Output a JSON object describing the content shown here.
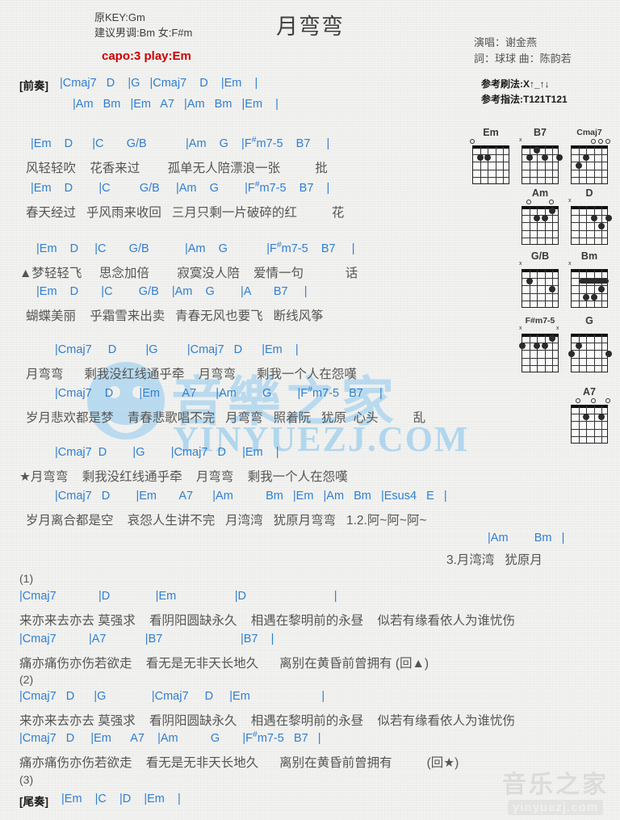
{
  "header": {
    "original_key": "原KEY:Gm",
    "suggested_key": "建议男调:Bm 女:F#m",
    "capo": "capo:3 play:Em",
    "title": "月弯弯",
    "singer": "演唱：谢金燕",
    "credits": "詞：球球  曲：陈韵若",
    "strum_pattern": "参考刷法:X↑_↑↓",
    "picking_pattern": "参考指法:T121T121",
    "capo_color": "#cc0000",
    "chord_color": "#2f7fd1",
    "lyric_color": "#555555"
  },
  "intro": {
    "label": "[前奏]",
    "line1": "|Cmaj7   D    |G   |Cmaj7    D    |Em    |",
    "line2": "|Am   Bm   |Em   A7   |Am   Bm   |Em    |"
  },
  "sections": [
    {
      "name": "verse-1",
      "rows": [
        {
          "chords": "|Em    D      |C       G/B            |Am    G    |F#m7-5    B7     |",
          "lyrics": "风轻轻吹    花香来过        孤单无人陪漂浪一张          批"
        },
        {
          "chords": "|Em    D        |C         G/B     |Am    G        |F#m7-5    B7    |",
          "lyrics": "春天经过   乎风雨来收回   三月只剩一片破碎的红          花"
        }
      ]
    },
    {
      "name": "verse-2",
      "rows": [
        {
          "chords": "|Em    D     |C       G/B           |Am    G            |F#m7-5    B7     |",
          "lyrics": "▲梦轻轻飞     思念加倍        寂寞没人陪    爱情一句            话"
        },
        {
          "chords": "|Em    D       |C        G/B    |Am    G        |A       B7     |",
          "lyrics": "蝴蝶美丽    乎霜雪来出卖   青春无风也要飞   断线风筝"
        }
      ]
    },
    {
      "name": "chorus-1",
      "rows": [
        {
          "chords": "|Cmaj7     D         |G         |Cmaj7   D      |Em    |",
          "lyrics": "月弯弯      剩我没红线通乎牵    月弯弯      剩我一个人在怨嘆"
        },
        {
          "chords": "|Cmaj7    D        |Em       A7      |Am        G        |F#m7-5   B7     |",
          "lyrics": "岁月悲欢都是梦    青春悲歌唱不完   月弯弯   照着阮   犹原  心头          乱"
        }
      ]
    },
    {
      "name": "chorus-2",
      "rows": [
        {
          "chords": "|Cmaj7  D        |G        |Cmaj7   D     |Em    |",
          "lyrics": "★月弯弯    剩我没红线通乎牵    月弯弯    剩我一个人在怨嘆"
        },
        {
          "chords": "|Cmaj7   D        |Em       A7      |Am          Bm   |Em   |Am   Bm   |Esus4   E   |",
          "lyrics": "岁月离合都是空    哀怨人生讲不完   月湾湾   犹原月弯弯   1.2.阿~阿~阿~"
        },
        {
          "chords": "|Am        Bm   |",
          "lyrics": "3.月湾湾   犹原月"
        }
      ]
    },
    {
      "name": "ending-1",
      "label": "(1)",
      "rows": [
        {
          "chords": "|Cmaj7             |D              |Em                  |D                           |",
          "lyrics": "来亦来去亦去 莫强求    看阴阳圆缺永久    相遇在黎明前的永昼    似若有缘看依人为谁忧伤"
        },
        {
          "chords": "|Cmaj7          |A7            |B7                        |B7    |",
          "lyrics": "痛亦痛伤亦伤若欲走    看无是无非天长地久      离别在黄昏前曾拥有 (回▲)"
        }
      ]
    },
    {
      "name": "ending-2",
      "label": "(2)",
      "rows": [
        {
          "chords": "|Cmaj7   D      |G              |Cmaj7     D     |Em                      |",
          "lyrics": "来亦来去亦去 莫强求    看阴阳圆缺永久    相遇在黎明前的永昼    似若有缘看依人为谁忧伤"
        },
        {
          "chords": "|Cmaj7   D     |Em      A7    |Am          G       |F#m7-5   B7   |",
          "lyrics": "痛亦痛伤亦伤若欲走    看无是无非天长地久      离别在黄昏前曾拥有          (回★)"
        }
      ]
    },
    {
      "name": "ending-3",
      "label": "(3)",
      "outro_label": "[尾奏]",
      "outro_chords": "|Em    |C    |D    |Em    |"
    }
  ],
  "chord_diagrams": [
    {
      "name": "Em",
      "top_markers": [
        {
          "type": "o",
          "string": 1
        }
      ],
      "dots": [
        {
          "string": 2,
          "fret": 2
        },
        {
          "string": 3,
          "fret": 2
        }
      ],
      "barre": null
    },
    {
      "name": "B7",
      "top_markers": [
        {
          "type": "x",
          "string": 1
        }
      ],
      "dots": [
        {
          "string": 2,
          "fret": 2
        },
        {
          "string": 3,
          "fret": 1
        },
        {
          "string": 4,
          "fret": 2
        },
        {
          "string": 6,
          "fret": 2
        }
      ],
      "barre": null
    },
    {
      "name": "Cmaj7",
      "top_markers": [
        {
          "type": "o",
          "string": 4
        },
        {
          "type": "o",
          "string": 5
        },
        {
          "type": "o",
          "string": 6
        }
      ],
      "dots": [
        {
          "string": 2,
          "fret": 3
        },
        {
          "string": 3,
          "fret": 2
        }
      ],
      "barre": null
    },
    {
      "name": "Am",
      "top_markers": [
        {
          "type": "o",
          "string": 2
        },
        {
          "type": "o",
          "string": 5
        }
      ],
      "dots": [
        {
          "string": 3,
          "fret": 2
        },
        {
          "string": 4,
          "fret": 2
        },
        {
          "string": 5,
          "fret": 1
        }
      ],
      "barre": null
    },
    {
      "name": "D",
      "top_markers": [
        {
          "type": "x",
          "string": 1
        }
      ],
      "dots": [
        {
          "string": 4,
          "fret": 2
        },
        {
          "string": 5,
          "fret": 3
        },
        {
          "string": 6,
          "fret": 2
        }
      ],
      "barre": null
    },
    {
      "name": "G/B",
      "top_markers": [
        {
          "type": "x",
          "string": 1
        }
      ],
      "dots": [
        {
          "string": 2,
          "fret": 2
        },
        {
          "string": 5,
          "fret": 3
        }
      ],
      "barre": null
    },
    {
      "name": "Bm",
      "top_markers": [
        {
          "type": "x",
          "string": 1
        }
      ],
      "dots": [
        {
          "string": 3,
          "fret": 4
        },
        {
          "string": 4,
          "fret": 4
        },
        {
          "string": 5,
          "fret": 3
        }
      ],
      "barre": {
        "fret": 2,
        "from": 2,
        "to": 6
      }
    },
    {
      "name": "F#m7-5",
      "top_markers": [
        {
          "type": "x",
          "string": 1
        },
        {
          "type": "x",
          "string": 6
        }
      ],
      "dots": [
        {
          "string": 1,
          "fret": 2
        },
        {
          "string": 3,
          "fret": 2
        },
        {
          "string": 4,
          "fret": 2
        },
        {
          "string": 5,
          "fret": 1
        }
      ],
      "barre": null
    },
    {
      "name": "G",
      "top_markers": [],
      "dots": [
        {
          "string": 2,
          "fret": 2
        },
        {
          "string": 1,
          "fret": 3
        },
        {
          "string": 6,
          "fret": 3
        }
      ],
      "barre": null
    },
    {
      "name": "A7",
      "top_markers": [
        {
          "type": "o",
          "string": 2
        },
        {
          "type": "o",
          "string": 4
        },
        {
          "type": "o",
          "string": 6
        }
      ],
      "dots": [
        {
          "string": 3,
          "fret": 2
        },
        {
          "string": 5,
          "fret": 2
        }
      ],
      "barre": null
    }
  ],
  "watermark": {
    "center_cn": "音樂之家",
    "center_url": "YINYUEZJ.COM",
    "corner_cn": "音乐之家",
    "corner_url": "yinyuezj.com"
  }
}
